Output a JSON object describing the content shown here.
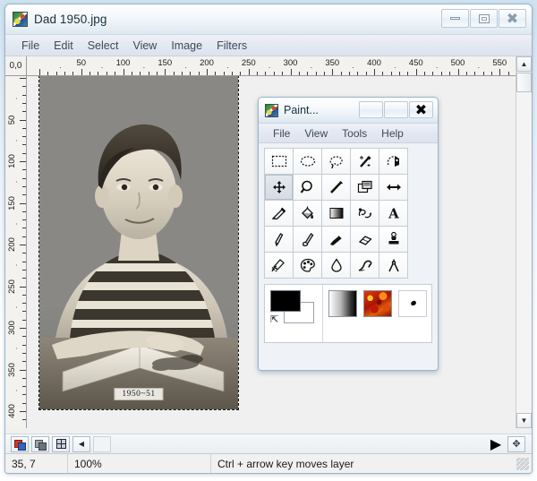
{
  "main_window": {
    "title": "Dad 1950.jpg",
    "icon": "app-image-icon",
    "controls": {
      "minimize": "–",
      "maximize": "□",
      "close": "✕"
    },
    "menu": [
      "File",
      "Edit",
      "Select",
      "View",
      "Image",
      "Filters"
    ]
  },
  "rulers": {
    "origin_label": "0,0",
    "horizontal_ticks": [
      50,
      100,
      150,
      200,
      250,
      300,
      350,
      400,
      450,
      500,
      550
    ],
    "vertical_ticks": [
      50,
      100,
      150,
      200,
      250,
      300,
      350,
      400
    ],
    "unit": "px"
  },
  "canvas": {
    "image_caption": "1950~51",
    "image_description": "Black and white vintage portrait photo of a young boy in a striped shirt leaning on an open book",
    "selection": "dashed-marching-ants"
  },
  "scrollbars": {
    "up_arrow": "▲",
    "down_arrow": "▼",
    "left_arrow": "◀",
    "right_arrow": "▶",
    "resize_grip": "✥"
  },
  "bottom_toolbar": {
    "buttons": [
      {
        "name": "layers-color-button",
        "icon": "layers-color-icon"
      },
      {
        "name": "layers-gray-button",
        "icon": "layers-gray-icon"
      },
      {
        "name": "grid-button",
        "icon": "grid-icon"
      },
      {
        "name": "scroll-left-button",
        "icon": "◀"
      },
      {
        "name": "scroll-track",
        "icon": ""
      }
    ],
    "right_buttons": [
      {
        "name": "scroll-right-button",
        "icon": "▶"
      },
      {
        "name": "pan-grip-button",
        "icon": "✥"
      }
    ]
  },
  "statusbar": {
    "coordinates": "35, 7",
    "zoom": "100%",
    "message": "Ctrl + arrow key moves layer"
  },
  "toolbox": {
    "title": "Paint...",
    "icon": "app-image-icon",
    "controls": {
      "minimize": "–",
      "maximize": "□",
      "close": "✕"
    },
    "menu": [
      "File",
      "View",
      "Tools",
      "Help"
    ],
    "tools": [
      {
        "name": "rectangle-select-tool",
        "label": "Rectangle Select",
        "selected": false
      },
      {
        "name": "ellipse-select-tool",
        "label": "Ellipse Select",
        "selected": false
      },
      {
        "name": "lasso-select-tool",
        "label": "Free Select",
        "selected": false
      },
      {
        "name": "magic-wand-tool",
        "label": "Magic Wand",
        "selected": false
      },
      {
        "name": "scissors-select-tool",
        "label": "Intelligent Scissors",
        "selected": false
      },
      {
        "name": "move-tool",
        "label": "Move",
        "selected": true
      },
      {
        "name": "zoom-tool",
        "label": "Zoom",
        "selected": false
      },
      {
        "name": "measure-tool",
        "label": "Measure",
        "selected": false
      },
      {
        "name": "crop-tool",
        "label": "Crop",
        "selected": false
      },
      {
        "name": "flip-tool",
        "label": "Flip",
        "selected": false
      },
      {
        "name": "color-picker-tool",
        "label": "Color Picker",
        "selected": false
      },
      {
        "name": "bucket-fill-tool",
        "label": "Bucket Fill",
        "selected": false
      },
      {
        "name": "gradient-tool",
        "label": "Gradient",
        "selected": false
      },
      {
        "name": "perspective-clone-tool",
        "label": "Perspective Clone",
        "selected": false
      },
      {
        "name": "text-tool",
        "label": "Text",
        "selected": false
      },
      {
        "name": "pencil-tool",
        "label": "Pencil",
        "selected": false
      },
      {
        "name": "paintbrush-tool",
        "label": "Paintbrush",
        "selected": false
      },
      {
        "name": "ink-tool",
        "label": "Ink",
        "selected": false
      },
      {
        "name": "eraser-tool",
        "label": "Eraser",
        "selected": false
      },
      {
        "name": "clone-stamp-tool",
        "label": "Clone",
        "selected": false
      },
      {
        "name": "airbrush-tool",
        "label": "Airbrush",
        "selected": false
      },
      {
        "name": "palette-tool",
        "label": "Palette",
        "selected": false
      },
      {
        "name": "blur-tool",
        "label": "Blur / Sharpen",
        "selected": false
      },
      {
        "name": "smudge-tool",
        "label": "Smudge",
        "selected": false
      },
      {
        "name": "dodge-burn-tool",
        "label": "Dodge / Burn",
        "selected": false
      }
    ],
    "swatches": {
      "primary_color": "#000000",
      "secondary_color": "#ffffff",
      "swap_icon": "swap-colors-icon",
      "gradient_label": "gradient-chip",
      "pattern_label": "pattern-chip",
      "brush_label": "brush-chip"
    }
  }
}
